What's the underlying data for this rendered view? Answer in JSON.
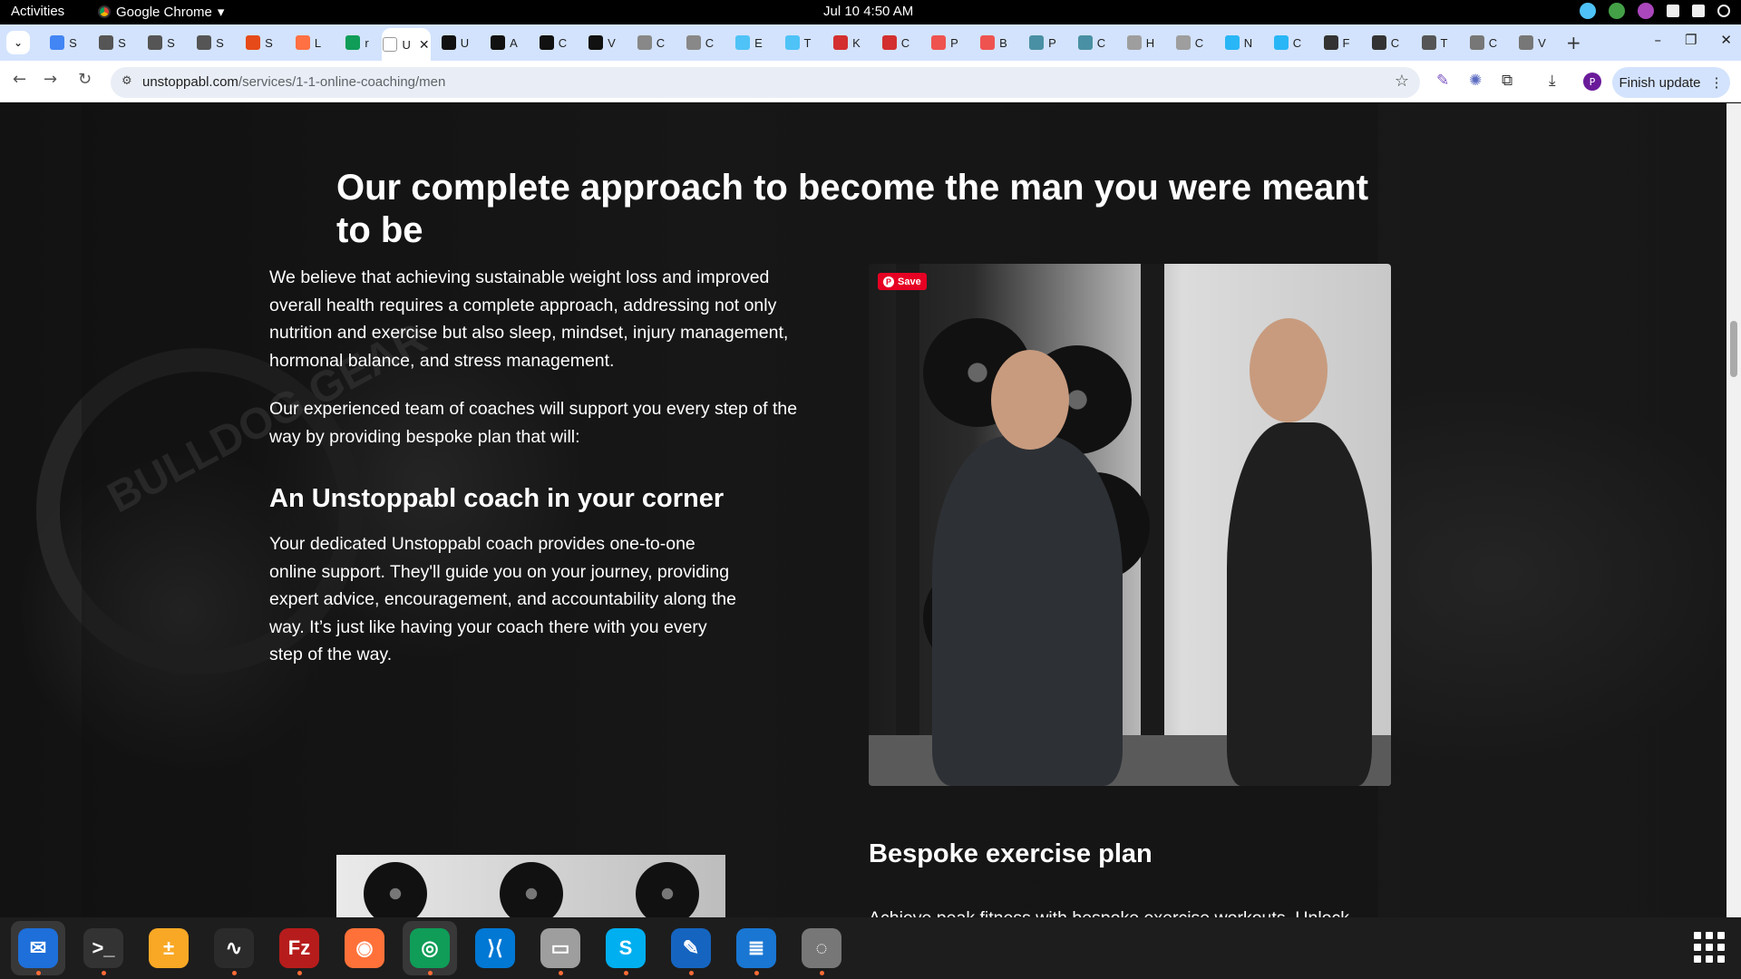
{
  "topbar": {
    "activities": "Activities",
    "app_name": "Google Chrome",
    "app_caret": "▾",
    "clock": "Jul 10  4:50 AM"
  },
  "tabs": [
    {
      "letter": "S",
      "color": "#4285f4"
    },
    {
      "letter": "S",
      "color": "#555555"
    },
    {
      "letter": "S",
      "color": "#555555"
    },
    {
      "letter": "S",
      "color": "#555555"
    },
    {
      "letter": "S",
      "color": "#e64a19"
    },
    {
      "letter": "L",
      "color": "#ff7043"
    },
    {
      "letter": "r",
      "color": "#0f9d58"
    },
    {
      "letter": "U",
      "color": "#ffffff",
      "active": true
    },
    {
      "letter": "U",
      "color": "#111111"
    },
    {
      "letter": "A",
      "color": "#111111"
    },
    {
      "letter": "C",
      "color": "#111111"
    },
    {
      "letter": "V",
      "color": "#111111"
    },
    {
      "letter": "C",
      "color": "#888888"
    },
    {
      "letter": "C",
      "color": "#888888"
    },
    {
      "letter": "E",
      "color": "#4fc3f7"
    },
    {
      "letter": "T",
      "color": "#4fc3f7"
    },
    {
      "letter": "K",
      "color": "#d32f2f"
    },
    {
      "letter": "C",
      "color": "#d32f2f"
    },
    {
      "letter": "P",
      "color": "#ef5350"
    },
    {
      "letter": "B",
      "color": "#ef5350"
    },
    {
      "letter": "P",
      "color": "#4a90a4"
    },
    {
      "letter": "C",
      "color": "#4a90a4"
    },
    {
      "letter": "H",
      "color": "#9e9e9e"
    },
    {
      "letter": "C",
      "color": "#9e9e9e"
    },
    {
      "letter": "N",
      "color": "#29b6f6"
    },
    {
      "letter": "C",
      "color": "#29b6f6"
    },
    {
      "letter": "F",
      "color": "#333333"
    },
    {
      "letter": "C",
      "color": "#333333"
    },
    {
      "letter": "T",
      "color": "#555555"
    },
    {
      "letter": "C",
      "color": "#777777"
    },
    {
      "letter": "V",
      "color": "#777777"
    }
  ],
  "toolbar": {
    "url_host": "unstoppabl.com",
    "url_path": "/services/1-1-online-coaching/men",
    "finish_update": "Finish update",
    "profile_initial": "P"
  },
  "page": {
    "heading": "Our complete approach to become the man you were meant to be",
    "intro_1": "We believe that achieving sustainable weight loss and improved overall health requires a complete approach, addressing not only nutrition and exercise but also sleep, mindset, injury management, hormonal balance, and stress management.",
    "intro_2": "Our experienced team of coaches will support you every step of the way by providing bespoke plan that will:",
    "coach_heading": "An Unstoppabl coach in your corner",
    "coach_text": "Your dedicated Unstoppabl coach provides one-to-one online support. They'll guide you on your journey, providing expert advice, encouragement, and accountability along the way. It’s just like having your coach there with you every step of the way.",
    "save_label": "Save",
    "exercise_heading": "Bespoke exercise plan",
    "exercise_text_partial": "Achieve peak fitness with bespoke exercise workouts. Unlock",
    "plate_brand": "BULLDOG GEAR"
  },
  "dock": [
    {
      "name": "thunderbird",
      "color": "#1e6fd9",
      "glyph": "✉",
      "dot": true,
      "active": true
    },
    {
      "name": "terminal",
      "color": "#333333",
      "glyph": ">_",
      "dot": true
    },
    {
      "name": "calculator",
      "color": "#f9a825",
      "glyph": "±",
      "dot": false
    },
    {
      "name": "system-monitor",
      "color": "#2b2b2b",
      "glyph": "∿",
      "dot": true
    },
    {
      "name": "filezilla",
      "color": "#b71c1c",
      "glyph": "Fz",
      "dot": true
    },
    {
      "name": "firefox",
      "color": "#ff7139",
      "glyph": "◉",
      "dot": false
    },
    {
      "name": "chrome",
      "color": "#0f9d58",
      "glyph": "◎",
      "dot": true,
      "active": true
    },
    {
      "name": "vscode",
      "color": "#0078d4",
      "glyph": "⟩⟨",
      "dot": false
    },
    {
      "name": "files",
      "color": "#9e9e9e",
      "glyph": "▭",
      "dot": true
    },
    {
      "name": "skype",
      "color": "#00aff0",
      "glyph": "S",
      "dot": true
    },
    {
      "name": "text-editor",
      "color": "#1565c0",
      "glyph": "✎",
      "dot": true
    },
    {
      "name": "libreoffice-writer",
      "color": "#1976d2",
      "glyph": "≣",
      "dot": true
    },
    {
      "name": "disk-utility",
      "color": "#777777",
      "glyph": "◌",
      "dot": true
    }
  ]
}
